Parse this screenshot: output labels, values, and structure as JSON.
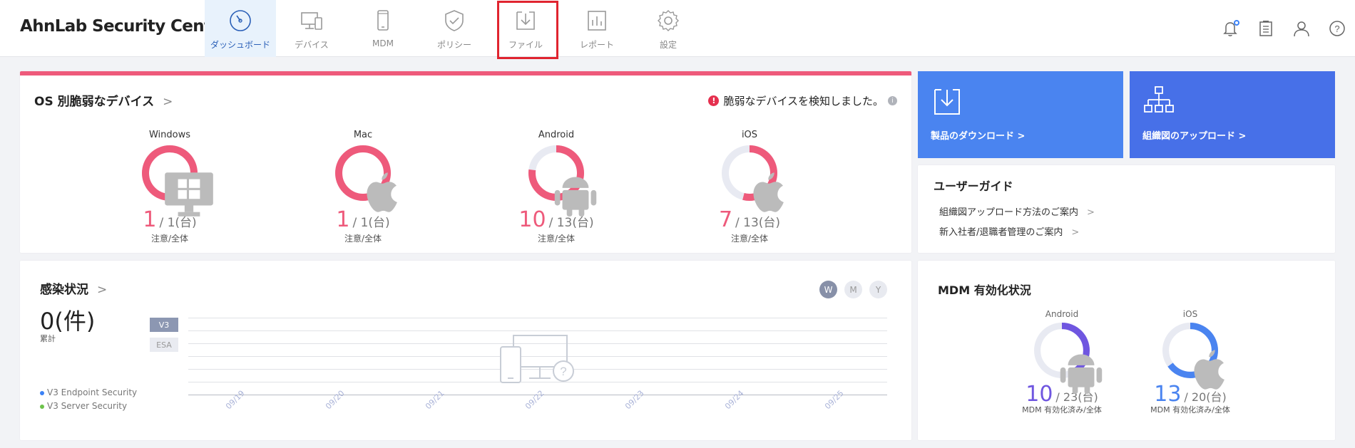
{
  "header": {
    "brand": "AhnLab Security Center",
    "nav": [
      {
        "label": "ダッシュボード"
      },
      {
        "label": "デバイス"
      },
      {
        "label": "MDM"
      },
      {
        "label": "ポリシー"
      },
      {
        "label": "ファイル"
      },
      {
        "label": "レポート"
      },
      {
        "label": "設定"
      }
    ],
    "icons": [
      "bell-icon",
      "clipboard-icon",
      "user-icon",
      "help-icon"
    ]
  },
  "os_card": {
    "title": "OS 別脆弱なデバイス",
    "chevron": ">",
    "alert_text": "脆弱なデバイスを検知しました。",
    "alert_mark": "!",
    "info_mark": "i",
    "items": [
      {
        "name": "Windows",
        "count": "1",
        "total": "/ 1(台)",
        "sub": "注意/全体",
        "ratio": 1.0,
        "icon": "windows-icon"
      },
      {
        "name": "Mac",
        "count": "1",
        "total": "/ 1(台)",
        "sub": "注意/全体",
        "ratio": 1.0,
        "icon": "apple-icon"
      },
      {
        "name": "Android",
        "count": "10",
        "total": "/ 13(台)",
        "sub": "注意/全体",
        "ratio": 0.77,
        "icon": "android-icon"
      },
      {
        "name": "iOS",
        "count": "7",
        "total": "/ 13(台)",
        "sub": "注意/全体",
        "ratio": 0.54,
        "icon": "apple-icon"
      }
    ],
    "color": "#ee5a7b"
  },
  "tiles": {
    "download": "製品のダウンロード >",
    "upload": "組織図のアップロード >"
  },
  "guide": {
    "title": "ユーザーガイド",
    "links": [
      "組織図アップロード方法のご案内",
      "新入社者/退職者管理のご案内"
    ],
    "chevron": ">"
  },
  "infection": {
    "title": "感染状況",
    "chevron": ">",
    "count": "0(件)",
    "count_sub": "累計",
    "period_buttons": [
      "W",
      "M",
      "Y"
    ],
    "tabs": [
      "V3",
      "ESA"
    ],
    "legend": [
      {
        "label": "V3 Endpoint Security",
        "color": "#3b82f6"
      },
      {
        "label": "V3 Server Security",
        "color": "#6cc24a"
      }
    ],
    "chart_data": {
      "type": "line",
      "title": "",
      "categories": [
        "09/19",
        "09/20",
        "09/21",
        "09/22",
        "09/23",
        "09/24",
        "09/25"
      ],
      "series": [],
      "xlabel": "",
      "ylabel": ""
    }
  },
  "mdm": {
    "title": "MDM 有効化状況",
    "items": [
      {
        "name": "Android",
        "count": "10",
        "total": "/ 23(台)",
        "sub": "MDM 有効化済み/全体",
        "ratio": 0.43,
        "color": "#6f56e0",
        "icon": "android-icon"
      },
      {
        "name": "iOS",
        "count": "13",
        "total": "/ 20(台)",
        "sub": "MDM 有効化済み/全体",
        "ratio": 0.65,
        "color": "#4a84f0",
        "icon": "apple-icon"
      }
    ]
  }
}
